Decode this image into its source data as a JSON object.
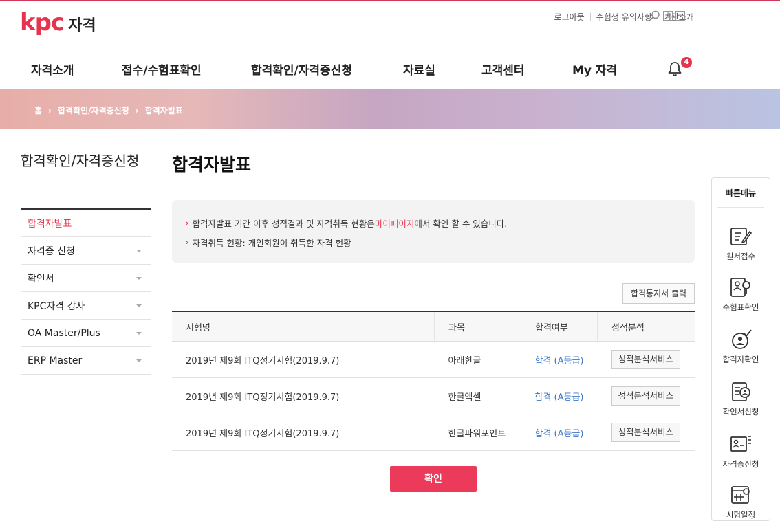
{
  "header": {
    "logo_mark": "kpc",
    "logo_text": "자격",
    "util_links": [
      "로그아웃",
      "수험생 유의사항",
      "기관소개"
    ],
    "zoom_in": "+",
    "zoom_out": "−",
    "gnb": [
      "자격소개",
      "접수/수험표확인",
      "합격확인/자격증신청",
      "자료실",
      "고객센터",
      "My 자격"
    ],
    "notification_count": "4"
  },
  "breadcrumb": [
    "홈",
    "합격확인/자격증신청",
    "합격자발표"
  ],
  "sidebar": {
    "title": "합격확인/자격증신청",
    "items": [
      {
        "label": "합격자발표"
      },
      {
        "label": "자격증 신청"
      },
      {
        "label": "확인서"
      },
      {
        "label": "KPC자격 강사"
      },
      {
        "label": "OA Master/Plus"
      },
      {
        "label": "ERP Master"
      }
    ]
  },
  "main": {
    "title": "합격자발표",
    "notice": {
      "line1_before": "합격자발표 기간 이후 성적결과 및 자격취득 현황은 ",
      "line1_link": "마이페이지",
      "line1_after": "에서 확인 할 수 있습니다.",
      "line2": "자격취득 현황: 개인회원이 취득한 자격 현황"
    },
    "print_button": "합격통지서 출력",
    "table": {
      "headers": [
        "시험명",
        "과목",
        "합격여부",
        "성적분석"
      ],
      "rows": [
        {
          "exam": "2019년 제9회 ITQ정기시험(2019.9.7)",
          "subject": "아래한글",
          "result": "합격 (A등급)",
          "analysis": "성적분석서비스"
        },
        {
          "exam": "2019년 제9회 ITQ정기시험(2019.9.7)",
          "subject": "한글엑셀",
          "result": "합격 (A등급)",
          "analysis": "성적분석서비스"
        },
        {
          "exam": "2019년 제9회 ITQ정기시험(2019.9.7)",
          "subject": "한글파워포인트",
          "result": "합격 (A등급)",
          "analysis": "성적분석서비스"
        }
      ]
    },
    "confirm_button": "확인"
  },
  "quick_menu": {
    "title": "빠른메뉴",
    "items": [
      "원서접수",
      "수험표확인",
      "합격자확인",
      "확인서신청",
      "자격증신청",
      "시험일정"
    ]
  },
  "colors": {
    "brand": "#e8334e",
    "pass": "#3a78c8",
    "button": "#ec3b5a"
  }
}
